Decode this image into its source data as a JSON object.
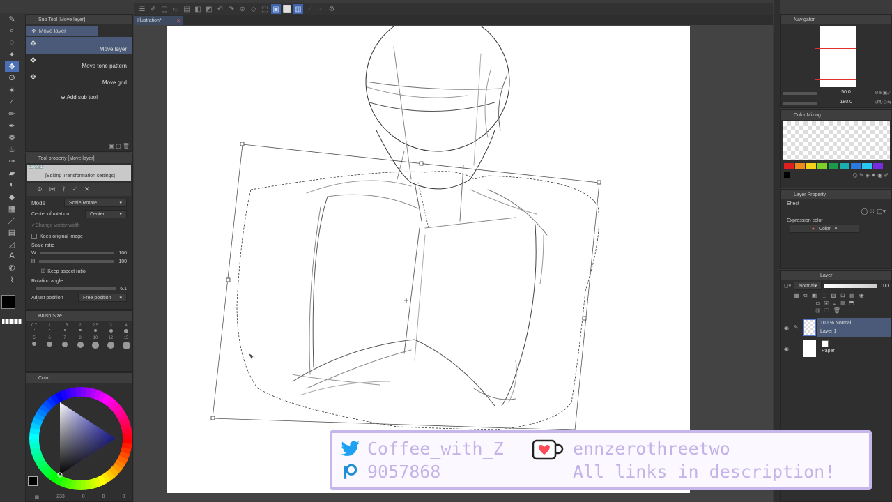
{
  "top_toolbar": {
    "icons": [
      "menu-icon",
      "pen-settings-icon",
      "undo-icon",
      "redo-icon",
      "clear-icon",
      "transform-icon",
      "select-icon",
      "ruler-icon"
    ]
  },
  "subtool_panel": {
    "title": "Sub Tool [Move layer]",
    "group_label": "Move layer",
    "items": [
      {
        "label": "Move layer"
      },
      {
        "label": "Move tone pattern"
      },
      {
        "label": "Move grid"
      }
    ],
    "add_label": "Add sub tool"
  },
  "tool_property": {
    "title": "Tool property [Move layer]",
    "preview_layer": "Layer 1",
    "editing_label": "[Editing Transformation settings]",
    "mode_label": "Mode",
    "mode_value": "Scale/Rotate",
    "center_label": "Center of rotation",
    "center_value": "Center",
    "change_vector_label": "Change vector width",
    "keep_original_label": "Keep original image",
    "scale_ratio_label": "Scale ratio",
    "w_label": "W",
    "w_value": "100",
    "h_label": "H",
    "h_value": "100",
    "keep_aspect_label": "Keep aspect ratio",
    "rotation_label": "Rotation angle",
    "rotation_value": "6.1",
    "adjust_label": "Adjust position",
    "adjust_value": "Free position"
  },
  "brush_size": {
    "title": "Brush Size",
    "sizes": [
      "0.7",
      "1",
      "1.5",
      "2",
      "2.5",
      "3",
      "4",
      "5",
      "6",
      "7",
      "8",
      "10",
      "12",
      "15"
    ]
  },
  "color_panel": {
    "title": "Colo",
    "footer_value": "233",
    "footer_a": "0",
    "footer_b": "0",
    "footer_c": "0"
  },
  "document_tab": {
    "label": "Illustration*"
  },
  "navigator": {
    "title": "Navigator",
    "zoom": "50.0",
    "rotation": "180.0"
  },
  "color_mixing": {
    "title": "Color Mixing",
    "palette": [
      "#e02020",
      "#f08a1a",
      "#f4d21a",
      "#7fd12a",
      "#1a9a4a",
      "#1ab0b0",
      "#2a7ae0",
      "#2ac8f0",
      "#7a2ae0"
    ]
  },
  "layer_property": {
    "title": "Layer Property",
    "effect_label": "Effect",
    "expression_label": "Expression color",
    "expression_value": "Color"
  },
  "layer_panel": {
    "title": "Layer",
    "blend_mode": "Normal",
    "opacity": "100",
    "layers": [
      {
        "blend": "100 % Normal",
        "name": "Layer 1"
      },
      {
        "blend": "",
        "name": "Paper"
      }
    ]
  },
  "banner": {
    "twitter": "Coffee_with_Z",
    "kofi": "ennzerothreetwo",
    "patreon": "9057868",
    "links": "All links in description!",
    "accent": "#c4b3e8"
  }
}
